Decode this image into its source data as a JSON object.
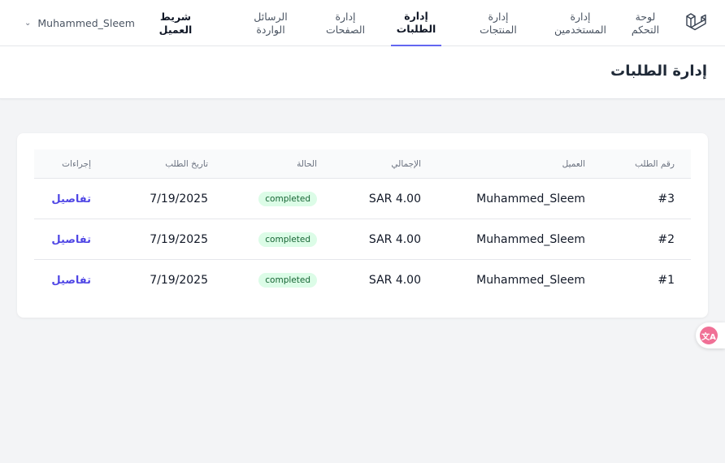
{
  "nav": {
    "items": [
      {
        "label": "لوحة\nالتحكم"
      },
      {
        "label": "إدارة\nالمستخدمين"
      },
      {
        "label": "إدارة\nالمنتجات"
      },
      {
        "label": "إدارة\nالطلبات"
      },
      {
        "label": "إدارة\nالصفحات"
      },
      {
        "label": "الرسائل\nالواردة"
      },
      {
        "label": "شريط\nالعميل"
      }
    ],
    "active_index": 3,
    "user_name": "Muhammed_Sleem"
  },
  "page": {
    "title": "إدارة الطلبات"
  },
  "table": {
    "headers": {
      "id": "رقم الطلب",
      "customer": "العميل",
      "total": "الإجمالي",
      "status": "الحالة",
      "date": "تاريخ الطلب",
      "actions": "إجراءات"
    },
    "rows": [
      {
        "id": "#3",
        "customer": "Muhammed_Sleem",
        "total": "SAR 4.00",
        "status": "completed",
        "date": "7/19/2025",
        "action": "تفاصيل"
      },
      {
        "id": "#2",
        "customer": "Muhammed_Sleem",
        "total": "SAR 4.00",
        "status": "completed",
        "date": "7/19/2025",
        "action": "تفاصيل"
      },
      {
        "id": "#1",
        "customer": "Muhammed_Sleem",
        "total": "SAR 4.00",
        "status": "completed",
        "date": "7/19/2025",
        "action": "تفاصيل"
      }
    ]
  },
  "icons": {
    "logo": "laravel-logo-icon",
    "user_chevron": "chevron-down-icon",
    "translate": "translate-icon"
  },
  "colors": {
    "accent": "#6366f1",
    "link": "#4f46e5",
    "badge_bg": "#dcfce7",
    "badge_text": "#166534",
    "translate": "#f07096"
  }
}
